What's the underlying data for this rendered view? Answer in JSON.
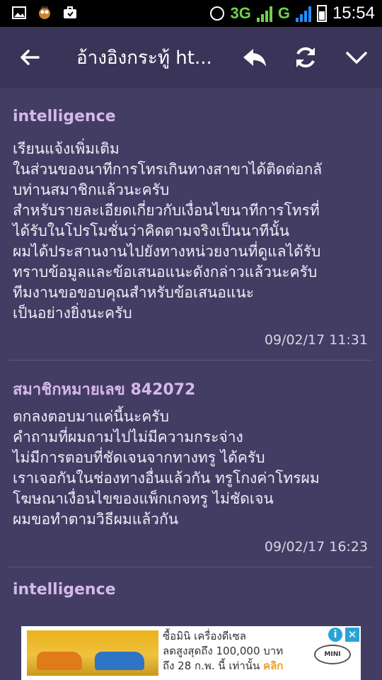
{
  "statusbar": {
    "network_label": "3G",
    "network_label_2": "G",
    "time": "15:54",
    "icons": [
      "image-icon",
      "owl-icon",
      "briefcase-icon",
      "alarm-icon",
      "battery-icon"
    ]
  },
  "appbar": {
    "title": "อ้างอิงกระทู้ ht...",
    "icons": [
      "back-arrow-icon",
      "reply-icon",
      "refresh-icon",
      "chevron-down-icon"
    ]
  },
  "posts": [
    {
      "author": "intelligence",
      "body": "เรียนแจ้งเพิ่มเติม\nในส่วนของนาทีการโทรเกินทางสาขาได้ติดต่อกลั\nบท่านสมาชิกแล้วนะครับ\nสำหรับรายละเอียดเกี่ยวกับเงื่อนไขนาทีการโทรที่\nได้รับในโปรโมชั่นว่าคิดตามจริงเป็นนาทีนั้น\nผมได้ประสานงานไปยังทางหน่วยงานที่ดูแลได้รับ\nทราบข้อมูลและข้อเสนอแนะดังกล่าวแล้วนะครับ\nทีมงานขอขอบคุณสำหรับข้อเสนอแนะ\nเป็นอย่างยิ่งนะครับ",
      "time": "09/02/17 11:31"
    },
    {
      "author": "สมาชิกหมายเลข 842072",
      "body": "ตกลงตอบมาแค่นี้นะครับ\nคำถามที่ผมถามไปไม่มีความกระจ่าง\nไม่มีการตอบที่ชัดเจนจากทางทรู ได้ครับ\nเราเจอกันในช่องทางอื่นแล้วกัน ทรูโกงค่าโทรผม\nโฆษณาเงื่อนไขของแพ็กเกจทรู ไม่ชัดเจน\nผมขอทำตามวิธีผมแล้วกัน",
      "time": "09/02/17 16:23"
    },
    {
      "author": "intelligence",
      "body": "",
      "time": ""
    }
  ],
  "ad": {
    "line1": "ซื้อมินิ เครื่องดีเซล",
    "line2": "ลดสูงสุดถึง 100,000 บาท",
    "line3": "ถึง 28 ก.พ. นี้ เท่านั้น",
    "cta": "คลิก",
    "info_label": "i",
    "close_label": "✕",
    "brand": "MINI",
    "colors": {
      "accent": "#f0a020",
      "info": "#29a3d6",
      "image_bg": "#eab21b"
    }
  },
  "colors": {
    "background": "#433d64",
    "appbar": "#3a3458",
    "author": "#d6b8ec",
    "body_text": "#f0eef8",
    "timestamp": "#d8d5e6",
    "network": "#6fd14a"
  }
}
